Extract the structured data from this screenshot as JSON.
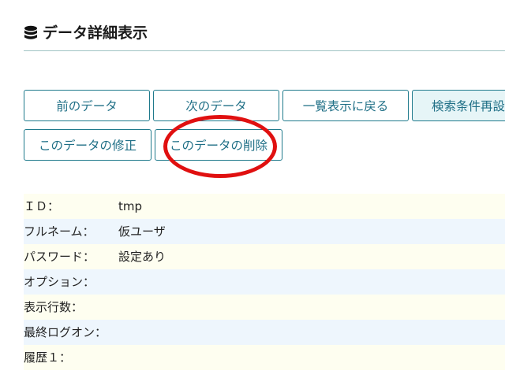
{
  "header": {
    "title": "データ詳細表示",
    "icon": "database-icon"
  },
  "buttons": {
    "prev": "前のデータ",
    "next": "次のデータ",
    "list": "一覧表示に戻る",
    "search": "検索条件再設定",
    "edit": "このデータの修正",
    "delete": "このデータの削除"
  },
  "details": [
    {
      "label": "ＩＤ：",
      "value": "tmp"
    },
    {
      "label": "フルネーム：",
      "value": "仮ユーザ"
    },
    {
      "label": "パスワード：",
      "value": "設定あり"
    },
    {
      "label": "オプション：",
      "value": ""
    },
    {
      "label": "表示行数：",
      "value": ""
    },
    {
      "label": "最終ログオン：",
      "value": ""
    },
    {
      "label": "履歴１：",
      "value": ""
    }
  ],
  "colors": {
    "accent": "#1f6f86",
    "highlight": "#e01010"
  }
}
